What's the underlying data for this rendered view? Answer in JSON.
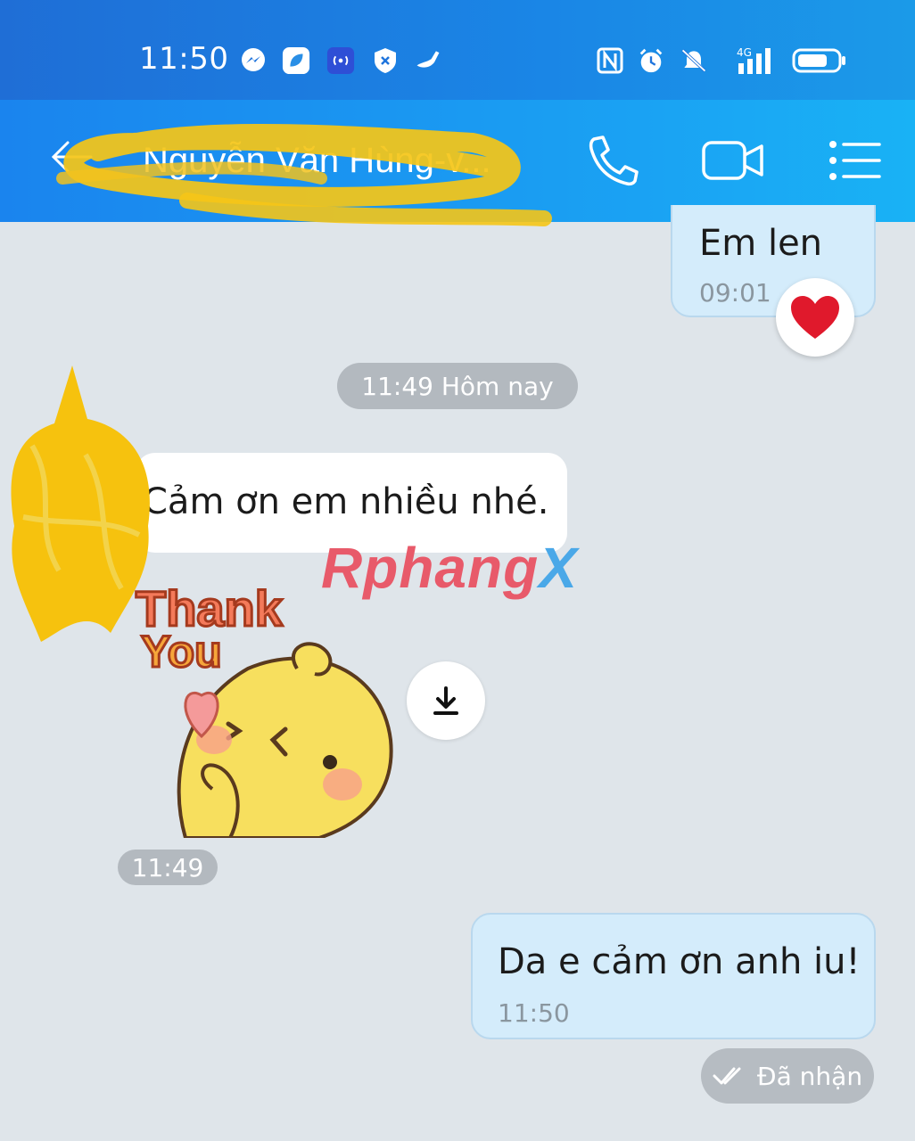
{
  "status_bar": {
    "time": "11:50",
    "icons": [
      "messenger-icon",
      "app-icon",
      "hotspot-icon",
      "shield-icon",
      "cleaner-icon",
      "nfc-icon",
      "alarm-icon",
      "mute-icon",
      "signal-4g-icon",
      "battery-icon"
    ],
    "network": "4G"
  },
  "header": {
    "contact_name": "Nguyễn Văn Hùng-v...",
    "icons": {
      "back": "back-arrow-icon",
      "call": "phone-icon",
      "video": "video-camera-icon",
      "menu": "menu-icon"
    }
  },
  "messages": [
    {
      "direction": "out",
      "text": "Em len",
      "time": "09:01",
      "reaction": "heart-icon"
    },
    {
      "type": "date_separator",
      "text": "11:49 Hôm nay"
    },
    {
      "direction": "in",
      "text": "Cảm ơn em nhiều nhé."
    },
    {
      "direction": "in",
      "type": "sticker",
      "sticker_text": [
        "Thank",
        "You"
      ],
      "time": "11:49"
    },
    {
      "direction": "out",
      "text": "Da e cảm ơn anh iu!",
      "time": "11:50"
    }
  ],
  "delivery_status": "Đã nhận",
  "watermark": {
    "part1": "Rphang",
    "part2": "X"
  },
  "colors": {
    "header": "#1a9af0",
    "bubble_out": "#d4ecfb",
    "bubble_in": "#ffffff",
    "background": "#dfe5ea",
    "heart": "#e0192c"
  }
}
